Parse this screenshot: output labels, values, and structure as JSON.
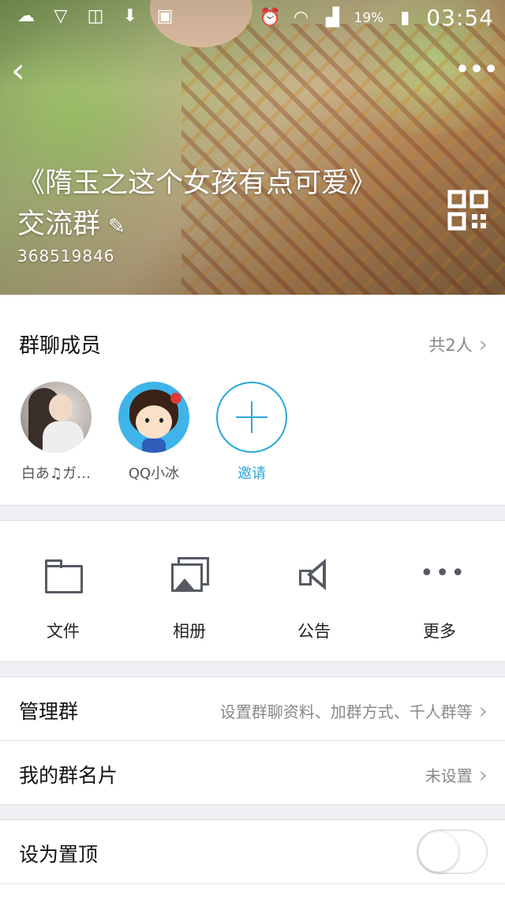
{
  "status_bar": {
    "battery": "19%",
    "time": "03:54",
    "icons": [
      "cloud-icon",
      "vpn-icon",
      "bag-icon",
      "download-icon",
      "screenshot-icon",
      "alarm-icon",
      "wifi-icon",
      "signal-icon",
      "battery-icon"
    ]
  },
  "header": {
    "group_name": "《隋玉之这个女孩有点可爱》交流群",
    "group_id": "368519846"
  },
  "members": {
    "title": "群聊成员",
    "count": "共2人",
    "list": [
      {
        "name": "白あ♫ガ…"
      },
      {
        "name": "QQ小冰"
      }
    ],
    "invite_label": "邀请"
  },
  "actions": {
    "files": "文件",
    "album": "相册",
    "notice": "公告",
    "more": "更多"
  },
  "settings": {
    "manage": {
      "label": "管理群",
      "value": "设置群聊资料、加群方式、千人群等"
    },
    "my_card": {
      "label": "我的群名片",
      "value": "未设置"
    },
    "pin": {
      "label": "设为置顶",
      "enabled": false
    }
  },
  "colors": {
    "accent": "#2aa7d9",
    "icon_gray": "#555a63",
    "background": "#efeff4"
  }
}
